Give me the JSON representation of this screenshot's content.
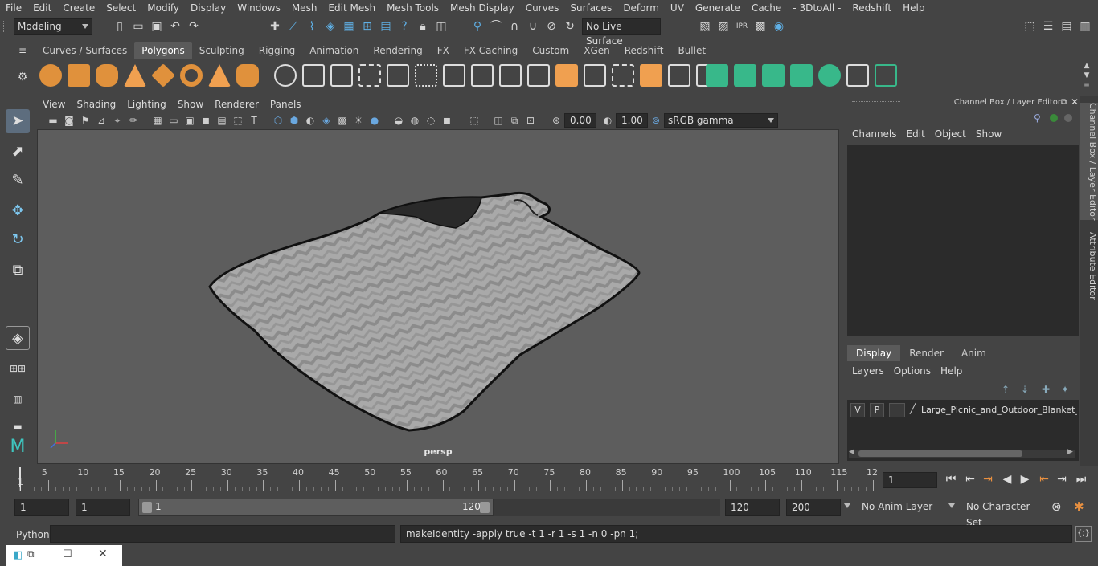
{
  "menubar": [
    "File",
    "Edit",
    "Create",
    "Select",
    "Modify",
    "Display",
    "Windows",
    "Mesh",
    "Edit Mesh",
    "Mesh Tools",
    "Mesh Display",
    "Curves",
    "Surfaces",
    "Deform",
    "UV",
    "Generate",
    "Cache",
    "- 3DtoAll -",
    "Redshift",
    "Help"
  ],
  "statusline": {
    "mode": "Modeling",
    "live_surface": "No Live Surface"
  },
  "shelf": {
    "tabs": [
      "Curves / Surfaces",
      "Polygons",
      "Sculpting",
      "Rigging",
      "Animation",
      "Rendering",
      "FX",
      "FX Caching",
      "Custom",
      "XGen",
      "Redshift",
      "Bullet"
    ],
    "active_tab": "Polygons"
  },
  "viewport": {
    "menu": [
      "View",
      "Shading",
      "Lighting",
      "Show",
      "Renderer",
      "Panels"
    ],
    "exposure": "0.00",
    "gamma": "1.00",
    "color_space": "sRGB gamma",
    "camera_label": "persp"
  },
  "channel_box": {
    "title": "Channel Box / Layer Editor",
    "menu": [
      "Channels",
      "Edit",
      "Object",
      "Show"
    ]
  },
  "layer_editor": {
    "tabs": [
      "Display",
      "Render",
      "Anim"
    ],
    "active_tab": "Display",
    "menu": [
      "Layers",
      "Options",
      "Help"
    ],
    "layer": {
      "visible": "V",
      "playback": "P",
      "name": "Large_Picnic_and_Outdoor_Blanket_C"
    }
  },
  "side_tabs": [
    "Channel Box / Layer Editor",
    "Attribute Editor"
  ],
  "timeline": {
    "ticks": [
      5,
      10,
      15,
      20,
      25,
      30,
      35,
      40,
      45,
      50,
      55,
      60,
      65,
      70,
      75,
      80,
      85,
      90,
      95,
      100,
      105,
      110,
      115,
      12
    ],
    "current_frame_marker": "1",
    "current_frame": "1"
  },
  "range": {
    "start": "1",
    "playback_start": "1",
    "slider_start": "1",
    "slider_end": "120",
    "playback_end": "120",
    "end": "200",
    "anim_layer": "No Anim Layer",
    "character_set": "No Character Set"
  },
  "command_line": {
    "language": "Python",
    "input": "",
    "result": "makeIdentity -apply true -t 1 -r 1 -s 1 -n 0 -pn 1;"
  }
}
